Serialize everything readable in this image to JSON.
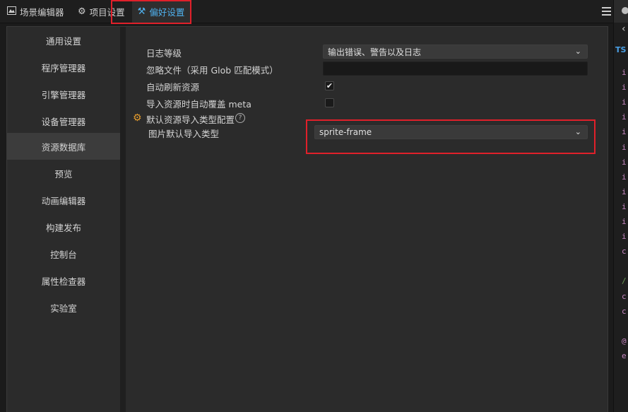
{
  "tabs": [
    {
      "label": "场景编辑器",
      "icon": "scene-editor-icon"
    },
    {
      "label": "项目设置",
      "icon": "gear-icon"
    },
    {
      "label": "偏好设置",
      "icon": "tools-icon"
    }
  ],
  "sidebar": {
    "items": [
      {
        "label": "通用设置"
      },
      {
        "label": "程序管理器"
      },
      {
        "label": "引擎管理器"
      },
      {
        "label": "设备管理器"
      },
      {
        "label": "资源数据库"
      },
      {
        "label": "预览"
      },
      {
        "label": "动画编辑器"
      },
      {
        "label": "构建发布"
      },
      {
        "label": "控制台"
      },
      {
        "label": "属性检查器"
      },
      {
        "label": "实验室"
      }
    ],
    "active_index": 4
  },
  "settings": {
    "log_level": {
      "label": "日志等级",
      "value": "输出错误、警告以及日志"
    },
    "ignore_files": {
      "label": "忽略文件（采用 Glob 匹配模式）",
      "value": ""
    },
    "auto_refresh": {
      "label": "自动刷新资源",
      "checked": true
    },
    "auto_overwrite_meta": {
      "label": "导入资源时自动覆盖 meta",
      "checked": false
    },
    "default_import_type": {
      "label": "默认资源导入类型配置",
      "help": "?"
    },
    "image_import_type": {
      "label": "图片默认导入类型",
      "value": "sprite-frame"
    }
  },
  "right_panel": {
    "tab_label": "TS",
    "code_letters": [
      "i",
      "i",
      "i",
      "i",
      "i",
      "i",
      "i",
      "i",
      "i",
      "i",
      "i",
      "i",
      "c",
      "",
      "/",
      "c",
      "c",
      "",
      "@",
      "e"
    ]
  },
  "colors": {
    "accent": "#4fb1ee",
    "highlight": "#e0202a",
    "gear": "#e39b2c"
  }
}
